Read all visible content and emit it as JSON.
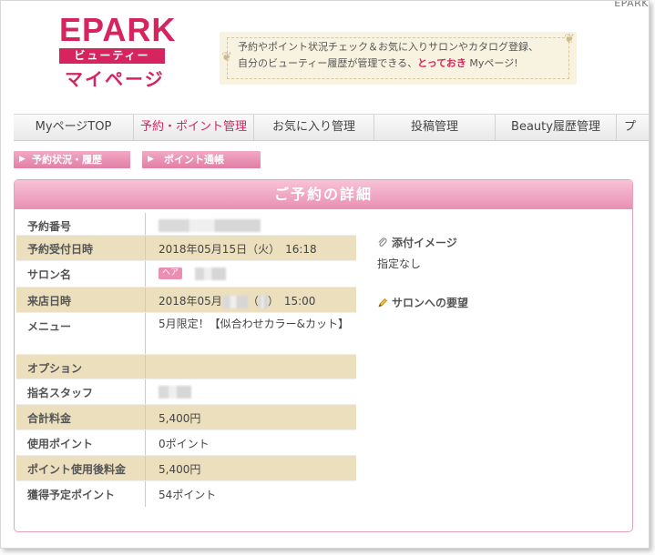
{
  "header": {
    "top_right": "EPARK",
    "logo": {
      "brand": "EPARK",
      "beauty": "ビューティー",
      "mypage": "マイページ"
    },
    "banner": {
      "line1": "予約やポイント状況チェック＆お気に入りサロンやカタログ登録、",
      "line2_before": "自分のビューティー履歴が管理できる、",
      "line2_highlight": "とっておき",
      "line2_after": " Myページ!"
    }
  },
  "nav": {
    "items": [
      {
        "label": "MyページTOP"
      },
      {
        "label": "予約・ポイント管理"
      },
      {
        "label": "お気に入り管理"
      },
      {
        "label": "投稿管理"
      },
      {
        "label": "Beauty履歴管理"
      },
      {
        "label": "プ"
      }
    ]
  },
  "subnav": {
    "reservation_history": "予約状況・履歴",
    "point_ledger": "ポイント通帳"
  },
  "detail": {
    "title": "ご予約の詳細",
    "rows": [
      {
        "label": "予約番号",
        "value": ""
      },
      {
        "label": "予約受付日時",
        "value": "2018年05月15日（火）　16:18"
      },
      {
        "label": "サロン名",
        "tag": "ヘア",
        "value": ""
      },
      {
        "label": "来店日時",
        "value_prefix": "2018年05月",
        "value_mid": "（",
        "value_suffix": "）　15:00"
      },
      {
        "label": "メニュー",
        "value": "5月限定！【似合わせカラー&カット】"
      },
      {
        "label": "オプション",
        "value": ""
      },
      {
        "label": "指名スタッフ",
        "value": ""
      },
      {
        "label": "合計料金",
        "value": "5,400円"
      },
      {
        "label": "使用ポイント",
        "value": "0ポイント"
      },
      {
        "label": "ポイント使用後料金",
        "value": "5,400円"
      },
      {
        "label": "獲得予定ポイント",
        "value": "54ポイント"
      }
    ],
    "attached_image": {
      "label": "添付イメージ",
      "value": "指定なし"
    },
    "salon_request": {
      "label": "サロンへの要望"
    }
  }
}
